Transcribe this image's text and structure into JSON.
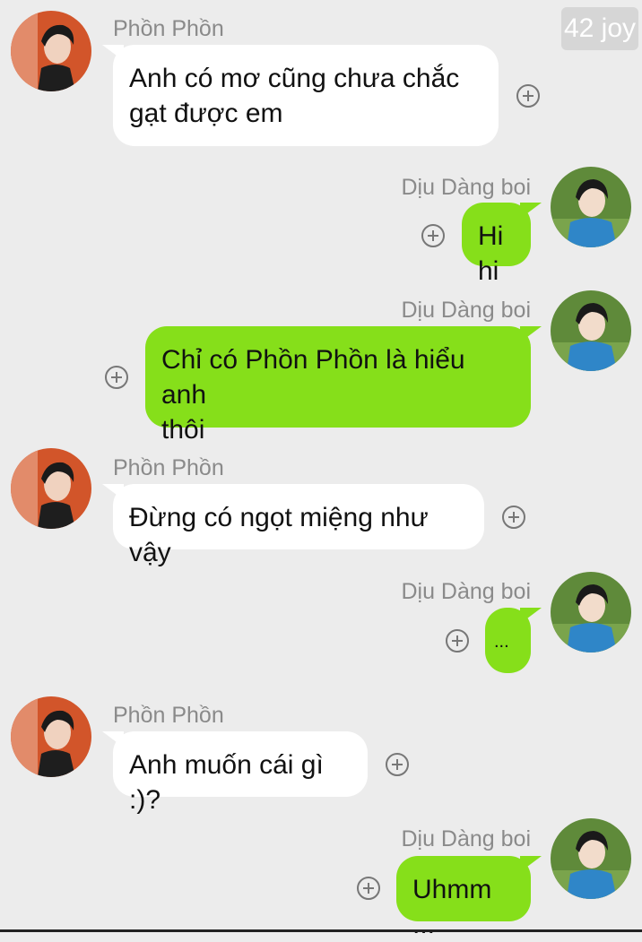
{
  "watermark": "42 joy",
  "participants": {
    "them": {
      "name": "Phồn Phồn",
      "avatar_icon": "male-avatar-icon"
    },
    "me": {
      "name": "Dịu Dàng boi",
      "avatar_icon": "male-avatar-icon"
    }
  },
  "messages": [
    {
      "from": "them",
      "sender": "Phồn Phồn",
      "text": "Anh có mơ cũng chưa chắc\ngạt được em"
    },
    {
      "from": "me",
      "sender": "Dịu Dàng boi",
      "text": "Hihi"
    },
    {
      "from": "me",
      "sender": "Dịu Dàng boi",
      "text": "Chỉ có Phồn Phồn là hiểu anh\nthôi"
    },
    {
      "from": "them",
      "sender": "Phồn Phồn",
      "text": "Đừng có ngọt miệng như vậy"
    },
    {
      "from": "me",
      "sender": "Dịu Dàng boi",
      "text": "..."
    },
    {
      "from": "them",
      "sender": "Phồn Phồn",
      "text": "Anh muốn cái gì :)?"
    },
    {
      "from": "me",
      "sender": "Dịu Dàng boi",
      "text": "Uhmm ..."
    }
  ]
}
